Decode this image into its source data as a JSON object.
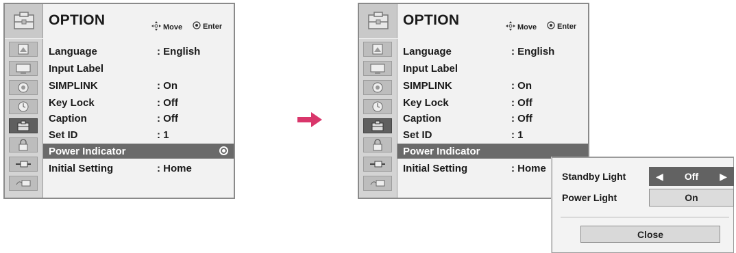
{
  "menu": {
    "title": "OPTION",
    "hint_move": "Move",
    "hint_enter": "Enter",
    "items": [
      {
        "label": "Language",
        "value": ": English"
      },
      {
        "label": "Input Label",
        "value": ""
      },
      {
        "label": "SIMPLINK",
        "value": ": On"
      },
      {
        "label": "Key Lock",
        "value": ": Off"
      },
      {
        "label": "Caption",
        "value": ": Off"
      },
      {
        "label": "Set ID",
        "value": ": 1"
      },
      {
        "label": "Power Indicator",
        "value": ""
      },
      {
        "label": "Initial Setting",
        "value": ": Home"
      }
    ],
    "selected_index": 6,
    "sidebar_icons": [
      "picture-icon",
      "screen-icon",
      "speaker-icon",
      "clock-icon",
      "option-icon",
      "lock-icon",
      "input-icon",
      "usb-icon"
    ],
    "sidebar_active_index": 4
  },
  "popup": {
    "standby_label": "Standby Light",
    "standby_value": "Off",
    "power_label": "Power Light",
    "power_value": "On",
    "close_label": "Close"
  },
  "colors": {
    "transition_arrow": "#d9366b",
    "selected_row": "#6a6a6a",
    "active_sidebar": "#5f5f5f"
  }
}
